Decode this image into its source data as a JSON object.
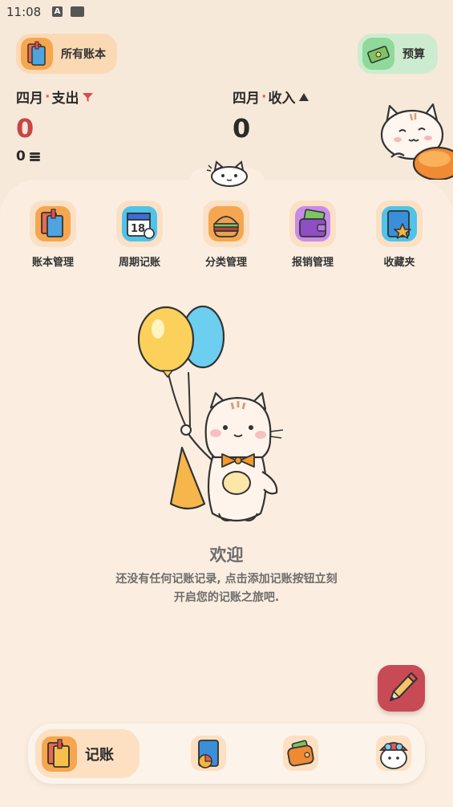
{
  "status_bar": {
    "time": "11:08"
  },
  "header": {
    "accounts_label": "所有账本",
    "budget_label": "预算"
  },
  "summary": {
    "expense_month": "四月",
    "expense_dot": "·",
    "expense_label": "支出",
    "expense_value": "0",
    "income_month": "四月",
    "income_dot": "·",
    "income_label": "收入",
    "income_value": "0",
    "budget_remaining": "0"
  },
  "quick_actions": [
    {
      "label": "账本管理",
      "icon": "book-icon"
    },
    {
      "label": "周期记账",
      "icon": "calendar-icon"
    },
    {
      "label": "分类管理",
      "icon": "burger-icon"
    },
    {
      "label": "报销管理",
      "icon": "wallet-icon"
    },
    {
      "label": "收藏夹",
      "icon": "star-folder-icon"
    }
  ],
  "empty_state": {
    "title": "欢迎",
    "message": "还没有任何记账记录, 点击添加记账按钮立刻开启您的记账之旅吧."
  },
  "bottom_nav": {
    "active_label": "记账"
  },
  "colors": {
    "background": "#f7e9d9",
    "sheet": "#fbeee0",
    "expense_red": "#c94545",
    "fab": "#c84a55"
  }
}
